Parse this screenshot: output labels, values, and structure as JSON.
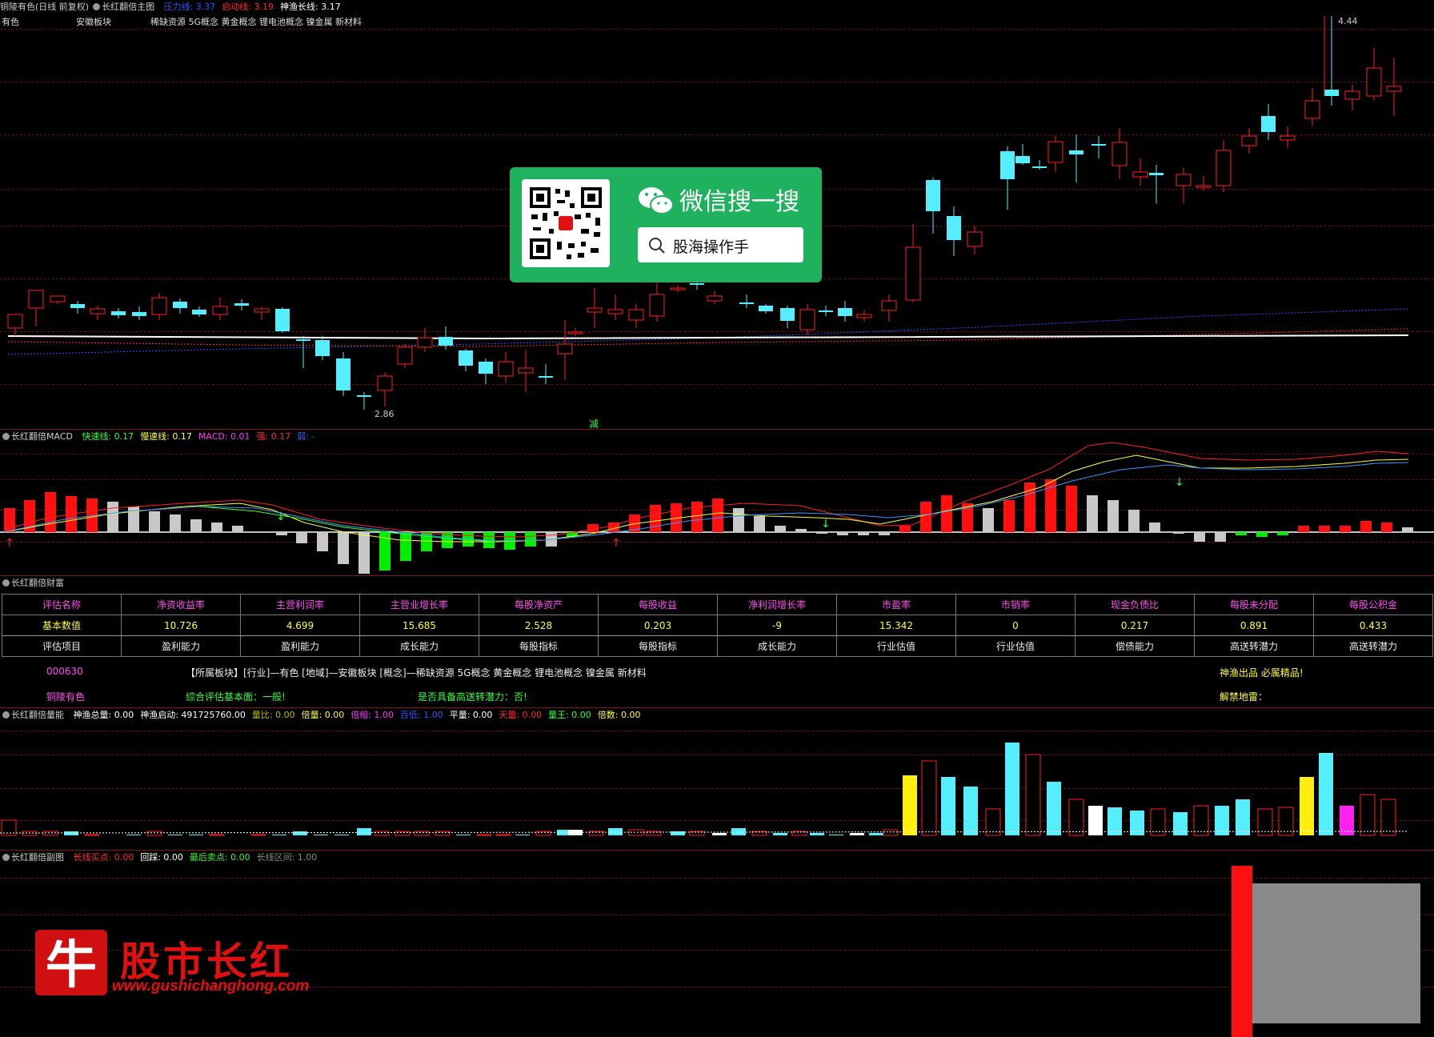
{
  "main_pane": {
    "stock_name": "铜陵有色(日线 前复权)",
    "indicator_name": "长红翻倍主图",
    "entries": [
      {
        "label": "压力线: 3.37",
        "color": "#2a55ff"
      },
      {
        "label": "启动线: 3.19",
        "color": "#ff2a2a"
      },
      {
        "label": "神渔长线: 3.17",
        "color": "#ffffff"
      }
    ],
    "row2": {
      "a": "有色",
      "b": "安徽板块",
      "c": "稀缺资源 5G概念 黄金概念 锂电池概念 镍金属 新材料"
    },
    "high_label": "4.44",
    "low_label": "2.86",
    "signal_label": "减"
  },
  "wechat_overlay": {
    "title": "微信搜一搜",
    "search_text": "股海操作手"
  },
  "macd_pane": {
    "name": "长红翻倍MACD",
    "entries": [
      {
        "label": "快速线: 0.17",
        "color": "#33ff33"
      },
      {
        "label": "慢速线: 0.17",
        "color": "#ffff33"
      },
      {
        "label": "MACD: 0.01",
        "color": "#ff33ff"
      },
      {
        "label": "强: 0.17",
        "color": "#ff3333"
      },
      {
        "label": "弱: -",
        "color": "#3366ff"
      }
    ]
  },
  "finance_pane": {
    "name": "长红翻倍财富",
    "headers": [
      "评估名称",
      "净资收益率",
      "主营利润率",
      "主营业增长率",
      "每股净资产",
      "每股收益",
      "净利润增长率",
      "市盈率",
      "市销率",
      "现金负债比",
      "每股未分配",
      "每股公积金"
    ],
    "values": [
      "基本数值",
      "10.726",
      "4.699",
      "15.685",
      "2.528",
      "0.203",
      "-9",
      "15.342",
      "0",
      "0.217",
      "0.891",
      "0.433"
    ],
    "items": [
      "评估项目",
      "盈利能力",
      "盈利能力",
      "成长能力",
      "每股指标",
      "每股指标",
      "成长能力",
      "行业估值",
      "行业估值",
      "偿债能力",
      "高送转潜力",
      "高送转潜力"
    ],
    "code": "000630",
    "name_cn": "铜陵有色",
    "sector_info": "【所属板块】[行业]—有色 [地域]—安徽板块 [概念]—稀缺资源 5G概念 黄金概念 锂电池概念 镍金属 新材料",
    "eval": "综合评估基本面：一般!",
    "high_send": "是否具备高送转潜力：否!",
    "right1": "神渔出品 必属精品!",
    "right2": "解禁地雷："
  },
  "volume_pane": {
    "name": "长红翻倍量能",
    "entries": [
      {
        "label": "神渔总量: 0.00",
        "color": "#ffffff"
      },
      {
        "label": "神渔启动: 491725760.00",
        "color": "#ffffff"
      },
      {
        "label": "量比: 0.00",
        "color": "#bbbb00"
      },
      {
        "label": "倍量: 0.00",
        "color": "#ffff33"
      },
      {
        "label": "倍缩: 1.00",
        "color": "#ff33ff"
      },
      {
        "label": "百低: 1.00",
        "color": "#3355ff"
      },
      {
        "label": "平量: 0.00",
        "color": "#ffffff"
      },
      {
        "label": "天量: 0.00",
        "color": "#ff2a2a"
      },
      {
        "label": "量王: 0.00",
        "color": "#33ff33"
      },
      {
        "label": "倍数: 0.00",
        "color": "#ffff33"
      }
    ]
  },
  "sub_pane": {
    "name": "长红翻倍副图",
    "entries": [
      {
        "label": "长线买点: 0.00",
        "color": "#ff2a2a"
      },
      {
        "label": "回踩: 0.00",
        "color": "#ffffff"
      },
      {
        "label": "最后卖点: 0.00",
        "color": "#33ff33"
      },
      {
        "label": "长线区间: 1.00",
        "color": "#888888"
      }
    ]
  },
  "logo": {
    "glyph": "牛",
    "text": "股市长红",
    "url": "www.gushichanghong.com"
  },
  "colors": {
    "up": "#ff2020",
    "down": "#55eeff",
    "grid": "#6a1010"
  }
}
